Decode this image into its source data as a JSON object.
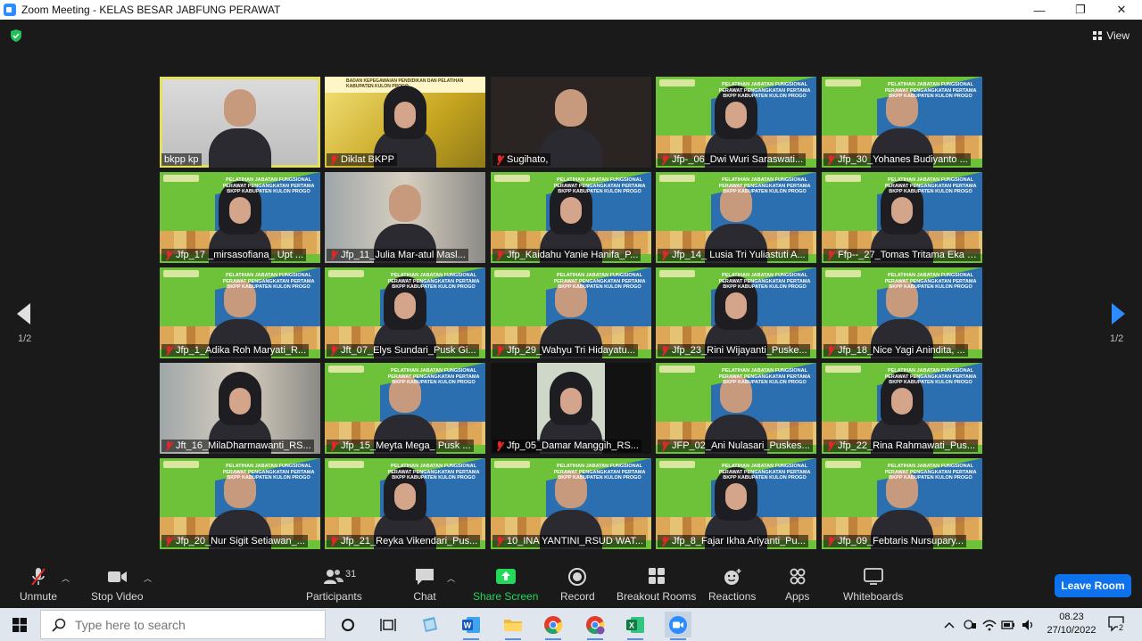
{
  "window": {
    "title": "Zoom Meeting - KELAS BESAR JABFUNG PERAWAT",
    "minimize": "—",
    "restore": "❐",
    "close": "✕"
  },
  "meeting": {
    "view_label": "View",
    "page_indicator_left": "1/2",
    "page_indicator_right": "1/2",
    "banner_text": "PELATIHAN JABATAN FUNGSIONAL PERAWAT PENGANGKATAN PERTAMA BKPP KABUPATEN KULON PROGO",
    "diklat_banner": "BADAN KEPEGAWAIAN PENDIDIKAN DAN PELATIHAN KABUPATEN KULON PROGO",
    "participants": [
      {
        "name": "bkpp kp",
        "muted": false,
        "active": true,
        "bg": "office"
      },
      {
        "name": "Diklat BKPP",
        "muted": true,
        "active": false,
        "bg": "yellow"
      },
      {
        "name": "Sugihato,",
        "muted": true,
        "active": false,
        "bg": "dark"
      },
      {
        "name": "Jfp-_06_Dwi Wuri Saraswati...",
        "muted": true,
        "active": false,
        "bg": "green"
      },
      {
        "name": "Jfp_30_Yohanes Budiyanto ...",
        "muted": true,
        "active": false,
        "bg": "green"
      },
      {
        "name": "Jfp_17 _mirsasofiana_ Upt ...",
        "muted": true,
        "active": false,
        "bg": "green"
      },
      {
        "name": "Jfp_11_Julia Mar-atul Masl...",
        "muted": true,
        "active": false,
        "bg": "curtain"
      },
      {
        "name": "Jfp_Kaidahu Yanie Hanifa_P...",
        "muted": true,
        "active": false,
        "bg": "green"
      },
      {
        "name": "Jfp_14_ Lusia Tri Yuliastuti A...",
        "muted": true,
        "active": false,
        "bg": "green"
      },
      {
        "name": "Ffp--_27_Tomas Tritama Eka B...",
        "muted": true,
        "active": false,
        "bg": "green"
      },
      {
        "name": "Jfp_1_Adika Roh Maryati_R...",
        "muted": true,
        "active": false,
        "bg": "green"
      },
      {
        "name": "Jft_07_Elys Sundari_Pusk Gi...",
        "muted": true,
        "active": false,
        "bg": "green"
      },
      {
        "name": "Jfp_29_Wahyu Tri Hidayatu...",
        "muted": true,
        "active": false,
        "bg": "green"
      },
      {
        "name": "Jfp_23_Rini Wijayanti_Puske...",
        "muted": true,
        "active": false,
        "bg": "green"
      },
      {
        "name": "Jfp_18_Nice Yagi Anindita, ...",
        "muted": true,
        "active": false,
        "bg": "green"
      },
      {
        "name": "Jft_16_MilaDharmawanti_RS...",
        "muted": true,
        "active": false,
        "bg": "curtain"
      },
      {
        "name": "Jfp_15_Meyta Mega_ Pusk ...",
        "muted": true,
        "active": false,
        "bg": "green"
      },
      {
        "name": "Jfp_05_Damar Manggih_RS...",
        "muted": true,
        "active": false,
        "bg": "black"
      },
      {
        "name": "JFP_02_Ani Nulasari_Puskes...",
        "muted": true,
        "active": false,
        "bg": "green"
      },
      {
        "name": "Jfp_22_Rina Rahmawati_Pus...",
        "muted": true,
        "active": false,
        "bg": "green"
      },
      {
        "name": "Jfp_20_Nur Sigit Setiawan_...",
        "muted": true,
        "active": false,
        "bg": "green"
      },
      {
        "name": "Jfp_21_Reyka Vikendari_Pus...",
        "muted": true,
        "active": false,
        "bg": "green"
      },
      {
        "name": "10_INA YANTINI_RSUD WAT...",
        "muted": true,
        "active": false,
        "bg": "green"
      },
      {
        "name": "Jfp_8_Fajar Ikha Ariyanti_Pu...",
        "muted": true,
        "active": false,
        "bg": "green"
      },
      {
        "name": "Jfp_09_Febtaris Nursupary...",
        "muted": true,
        "active": false,
        "bg": "green"
      }
    ]
  },
  "toolbar": {
    "unmute": "Unmute",
    "stop_video": "Stop Video",
    "participants": "Participants",
    "participants_count": "31",
    "chat": "Chat",
    "share_screen": "Share Screen",
    "record": "Record",
    "breakout_rooms": "Breakout Rooms",
    "reactions": "Reactions",
    "apps": "Apps",
    "whiteboards": "Whiteboards",
    "leave_room": "Leave Room",
    "accent_green": "#23d959",
    "leave_color": "#0e72ed"
  },
  "taskbar": {
    "search_placeholder": "Type here to search",
    "time": "08.23",
    "date": "27/10/2022",
    "notifications": "2"
  }
}
